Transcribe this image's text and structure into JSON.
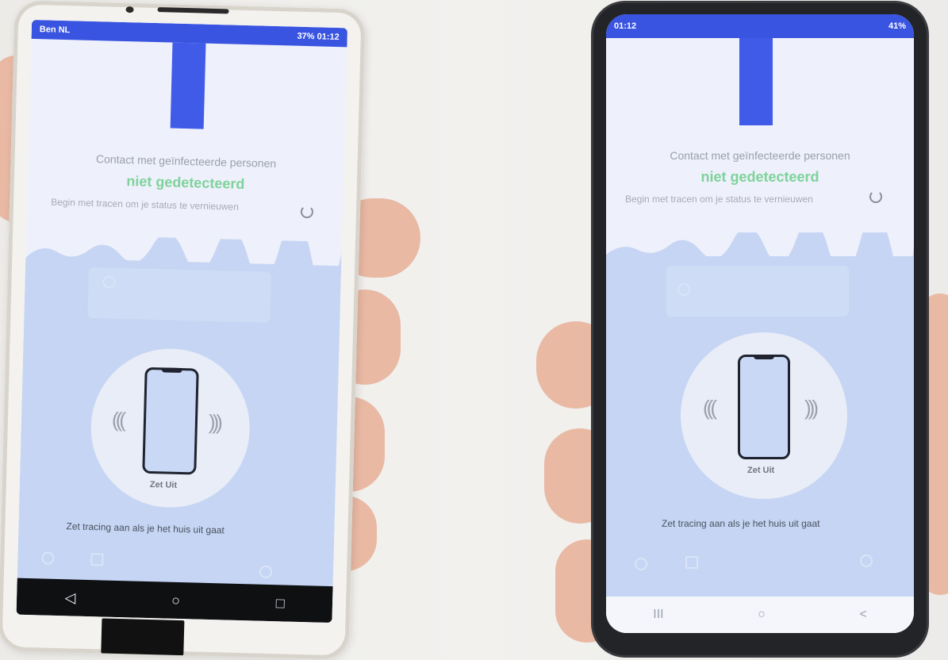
{
  "left_phone": {
    "status_left": "Ben NL",
    "status_right": "37% 01:12",
    "contact_title": "Contact met geïnfecteerde personen",
    "status_word": "niet gedetecteerd",
    "hint": "Begin met tracen om je status te vernieuwen",
    "off_label": "Zet Uit",
    "bottom_hint": "Zet tracing aan als je het huis uit gaat",
    "nav": [
      "◁",
      "○",
      "□"
    ]
  },
  "right_phone": {
    "status_left": "01:12",
    "status_right": "41%",
    "contact_title": "Contact met geïnfecteerde personen",
    "status_word": "niet gedetecteerd",
    "hint": "Begin met tracen om je status te vernieuwen",
    "off_label": "Zet Uit",
    "bottom_hint": "Zet tracing aan als je het huis uit gaat",
    "nav": [
      "III",
      "○",
      "<"
    ]
  },
  "colors": {
    "accent": "#3f5be8",
    "status_green": "#7dd39a",
    "wave": "#c5d5f3"
  }
}
